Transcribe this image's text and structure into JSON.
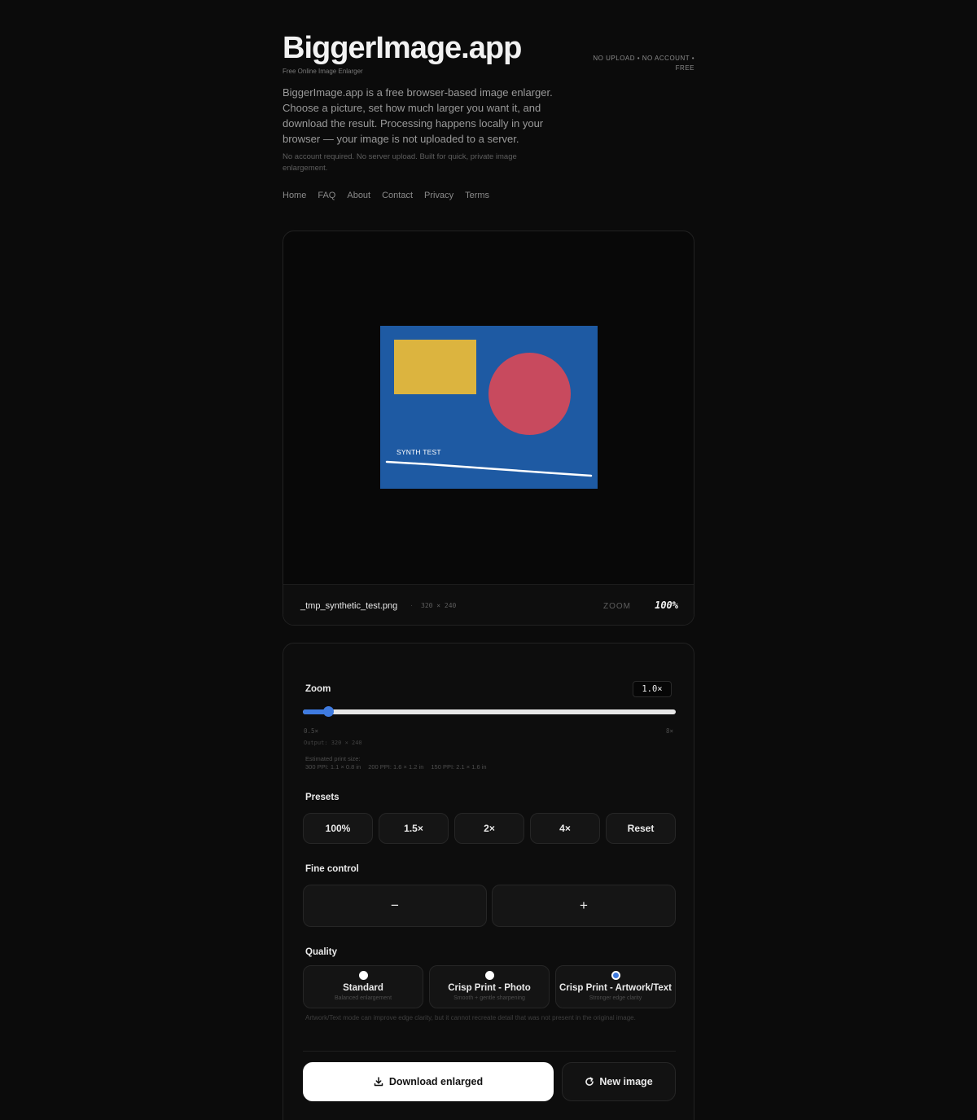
{
  "header": {
    "brand": "BiggerImage.app",
    "subtitle": "Free Online Image Enlarger",
    "tagline": "NO UPLOAD • NO ACCOUNT • FREE",
    "intro": "BiggerImage.app is a free browser-based image enlarger. Choose a picture, set how much larger you want it, and download the result. Processing happens locally in your browser — your image is not uploaded to a server.",
    "intro_small": "No account required. No server upload. Built for quick, private image enlargement."
  },
  "nav": [
    "Home",
    "FAQ",
    "About",
    "Contact",
    "Privacy",
    "Terms"
  ],
  "preview": {
    "image_text": "SYNTH TEST",
    "image_colors": {
      "background": "#1e5aa3",
      "rectangle": "#dcb43f",
      "circle": "#c84a5e",
      "line": "#ffffff"
    },
    "filename": "_tmp_synthetic_test.png",
    "separator": "·",
    "dimensions": "320 × 240",
    "zoom_label": "ZOOM",
    "zoom_value": "100%"
  },
  "controls": {
    "zoom_label": "Zoom",
    "zoom_value": "1.0×",
    "slider": {
      "min_label": "0.5×",
      "max_label": "8×",
      "min": 0.5,
      "max": 8,
      "value": 1.0,
      "accent": "#3f7be0"
    },
    "output_size": "Output: 320 × 240",
    "print_heading": "Estimated print size:",
    "print_sizes": [
      "300 PPI: 1.1 × 0.8 in",
      "200 PPI: 1.6 × 1.2 in",
      "150 PPI: 2.1 × 1.6 in"
    ],
    "presets_label": "Presets",
    "presets": [
      "100%",
      "1.5×",
      "2×",
      "4×",
      "Reset"
    ],
    "fine_label": "Fine control",
    "fine_minus": "−",
    "fine_plus": "+",
    "quality_label": "Quality",
    "quality_options": [
      {
        "name": "Standard",
        "desc": "Balanced enlargement",
        "selected": false
      },
      {
        "name": "Crisp Print - Photo",
        "desc": "Smooth + gentle sharpening",
        "selected": false
      },
      {
        "name": "Crisp Print - Artwork/Text",
        "desc": "Stronger edge clarity",
        "selected": true
      }
    ],
    "quality_note": "Artwork/Text mode can improve edge clarity, but it cannot recreate detail that was not present in the original image.",
    "download_label": "Download enlarged",
    "download_icon": "download-icon",
    "new_image_label": "New image",
    "new_image_icon": "refresh-icon"
  }
}
